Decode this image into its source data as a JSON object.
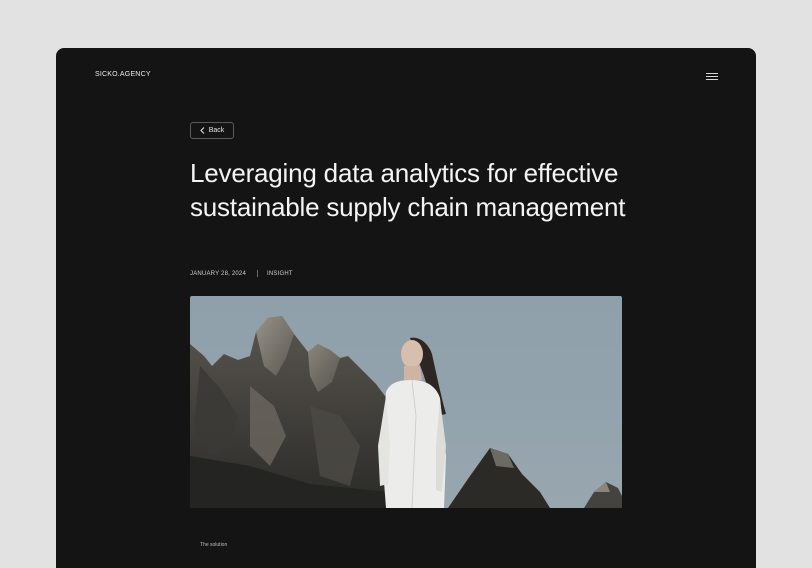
{
  "header": {
    "brand": "SICKO.AGENCY",
    "menu_icon": "hamburger-menu-icon"
  },
  "article": {
    "back_label": "Back",
    "back_icon": "chevron-left-icon",
    "title": "Leveraging data analytics for effective sustainable supply chain management",
    "date": "JANUARY 28, 2024",
    "category": "INSIGHT",
    "hero_image_alt": "Woman in white shirt standing in front of rocky mountain peaks",
    "section_label": "The solution"
  },
  "colors": {
    "page_background": "#e2e2e2",
    "window_background": "#141414",
    "text_primary": "#f4f4f4"
  }
}
